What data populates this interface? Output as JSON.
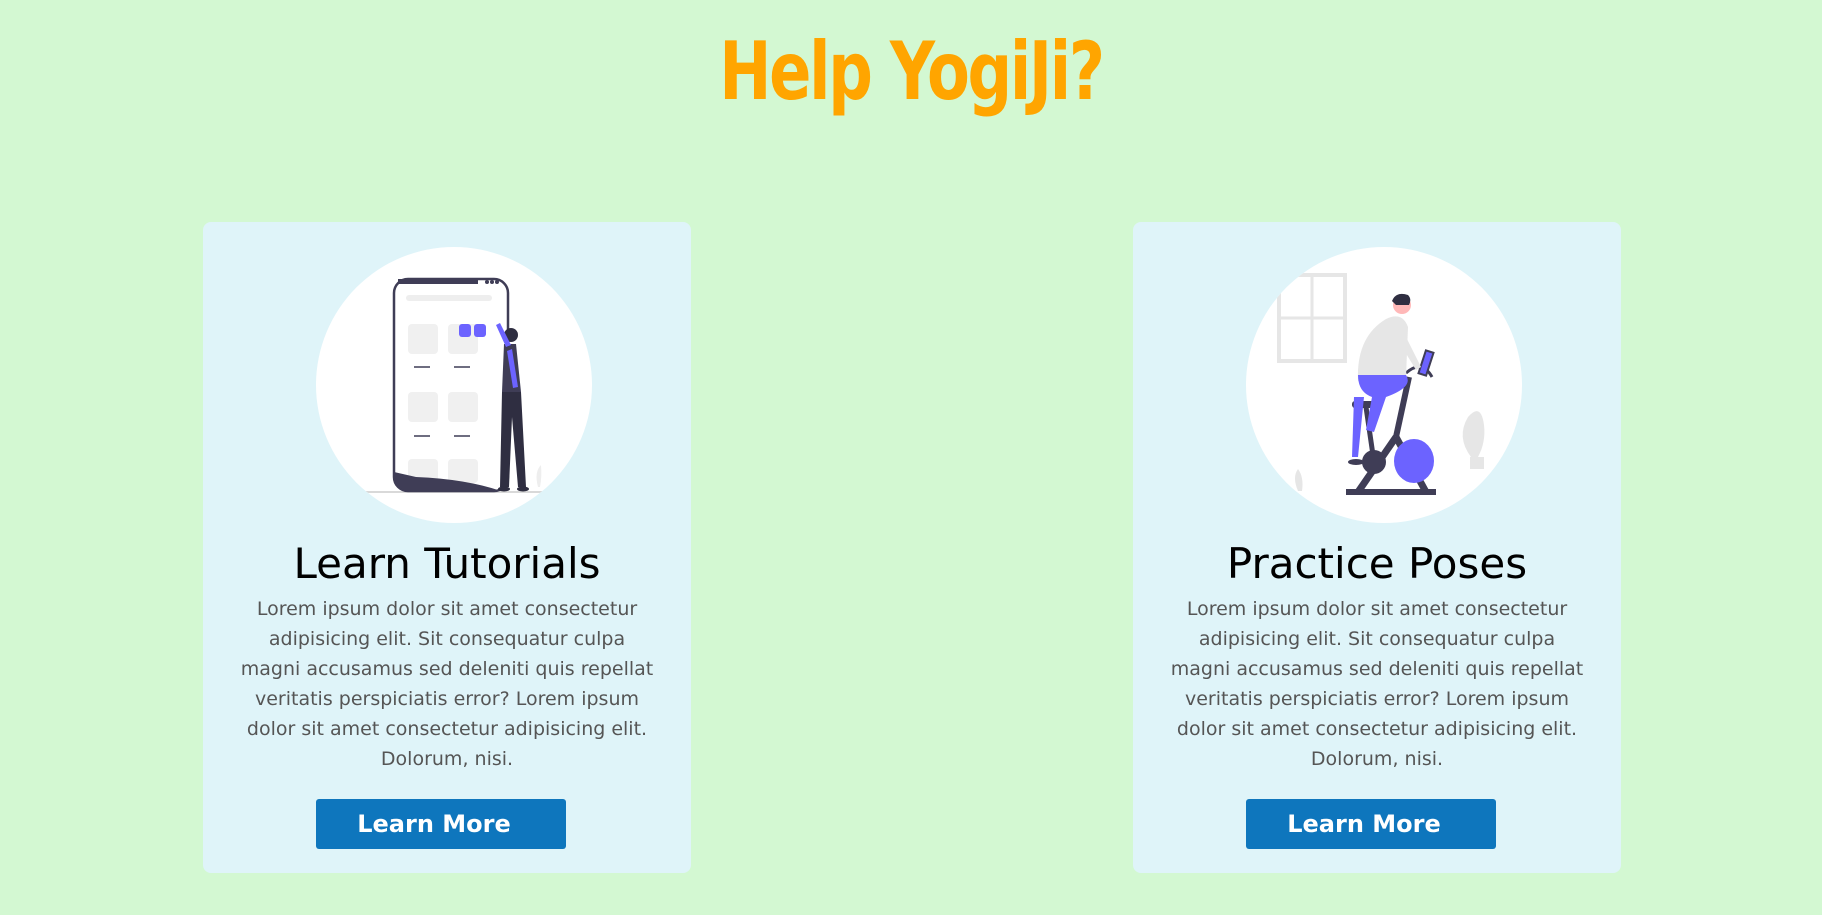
{
  "header": {
    "title": "Help YogiJi?"
  },
  "cards": [
    {
      "heading": "Learn Tutorials",
      "text": "Lorem ipsum dolor sit amet consectetur adipisicing elit. Sit consequatur culpa magni accusamus sed deleniti quis repellat veritatis perspiciatis error? Lorem ipsum dolor sit amet consectetur adipisicing elit. Dolorum, nisi.",
      "button_label": "Learn More",
      "illustration": "person-with-phone-illustration"
    },
    {
      "heading": "Practice Poses",
      "text": "Lorem ipsum dolor sit amet consectetur adipisicing elit. Sit consequatur culpa magni accusamus sed deleniti quis repellat veritatis perspiciatis error? Lorem ipsum dolor sit amet consectetur adipisicing elit. Dolorum, nisi.",
      "button_label": "Learn More",
      "illustration": "person-on-exercise-bike-illustration"
    }
  ],
  "colors": {
    "background": "#d3f8d2",
    "title": "#ffa500",
    "card_background": "#dff4f9",
    "button": "#0e76bd",
    "accent": "#6c63ff"
  }
}
